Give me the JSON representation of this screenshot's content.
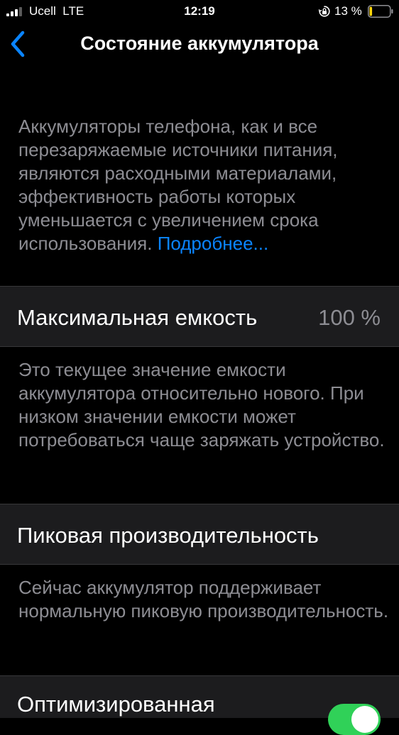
{
  "status_bar": {
    "carrier": "Ucell",
    "network": "LTE",
    "time": "12:19",
    "battery_percent": "13 %",
    "battery_level": 0.13,
    "battery_color": "#ffd60a"
  },
  "nav": {
    "back_icon": "chevron-left-icon",
    "title": "Состояние аккумулятора"
  },
  "intro": {
    "text": "Аккумуляторы телефона, как и все перезаряжаемые источники питания, являются расходными материалами, эффективность работы которых уменьшается с увеличением срока использования. ",
    "link": "Подробнее..."
  },
  "maximum_capacity": {
    "label": "Максимальная емкость",
    "value": "100 %",
    "description": "Это текущее значение емкости аккумулятора относительно нового. При низком значении емкости может потребоваться чаще заряжать устройство."
  },
  "peak_performance": {
    "label": "Пиковая производительность",
    "description": "Сейчас аккумулятор поддерживает нормальную пиковую производительность."
  },
  "optimized_charging": {
    "label": "Оптимизированная",
    "enabled": true
  },
  "colors": {
    "background": "#000000",
    "cell": "#1c1c1e",
    "secondary_text": "#8d8d93",
    "accent": "#0a84ff",
    "toggle_on": "#30d158"
  }
}
